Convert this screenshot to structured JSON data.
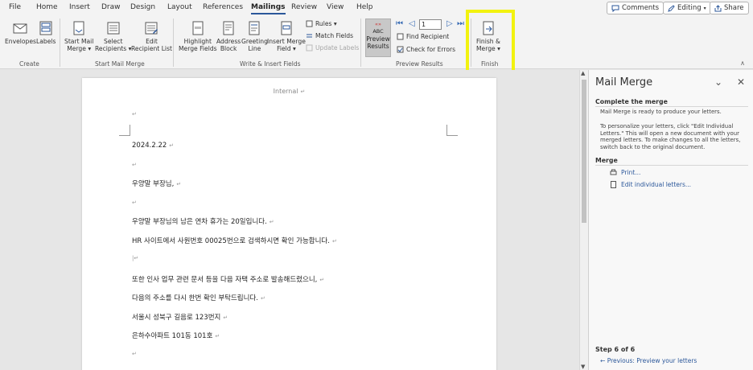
{
  "menu": {
    "tabs": [
      "File",
      "Home",
      "Insert",
      "Draw",
      "Design",
      "Layout",
      "References",
      "Mailings",
      "Review",
      "View",
      "Help"
    ],
    "active": "Mailings",
    "comments": "Comments",
    "editing": "Editing",
    "share": "Share"
  },
  "ribbon": {
    "create": {
      "label": "Create",
      "envelopes": "Envelopes",
      "labels": "Labels"
    },
    "start": {
      "label": "Start Mail Merge",
      "start_l1": "Start Mail",
      "start_l2": "Merge",
      "select_l1": "Select",
      "select_l2": "Recipients",
      "edit_l1": "Edit",
      "edit_l2": "Recipient List"
    },
    "write": {
      "label": "Write & Insert Fields",
      "highlight_l1": "Highlight",
      "highlight_l2": "Merge Fields",
      "address_l1": "Address",
      "address_l2": "Block",
      "greeting_l1": "Greeting",
      "greeting_l2": "Line",
      "insert_l1": "Insert Merge",
      "insert_l2": "Field",
      "rules": "Rules",
      "match": "Match Fields",
      "update": "Update Labels"
    },
    "preview": {
      "label": "Preview Results",
      "abc": "ABC",
      "preview_l1": "Preview",
      "preview_l2": "Results",
      "record": "1",
      "find": "Find Recipient",
      "check": "Check for Errors"
    },
    "finish": {
      "label": "Finish",
      "finish_l1": "Finish &",
      "finish_l2": "Merge"
    }
  },
  "document": {
    "header": "Internal",
    "lines": [
      "2024.2.22",
      "우양말 부장님,",
      "우양말 부장님의 남은 연차 휴가는 20일입니다.",
      "HR 사이트에서 사원번호 00025번으로 검색하시면 확인 가능합니다.",
      "또한 인사 업무 관련 문서 등을 다음 자택 주소로 발송해드렸으니,",
      "다음의 주소를 다시 한번 확인 부탁드립니다.",
      "서울시 성북구 길음로 123번지",
      "은하수아파트 101동 101호"
    ]
  },
  "pane": {
    "title": "Mail Merge",
    "complete_heading": "Complete the merge",
    "complete_text": "Mail Merge is ready to produce your letters.",
    "personalize_text": "To personalize your letters, click \"Edit Individual Letters.\" This will open a new document with your merged letters. To make changes to all the letters, switch back to the original document.",
    "merge_heading": "Merge",
    "print": "Print...",
    "edit_letters": "Edit individual letters...",
    "step": "Step 6 of 6",
    "previous": "Previous: Preview your letters"
  },
  "colors": {
    "accent": "#2b579a",
    "highlight": "#f2f20f"
  }
}
